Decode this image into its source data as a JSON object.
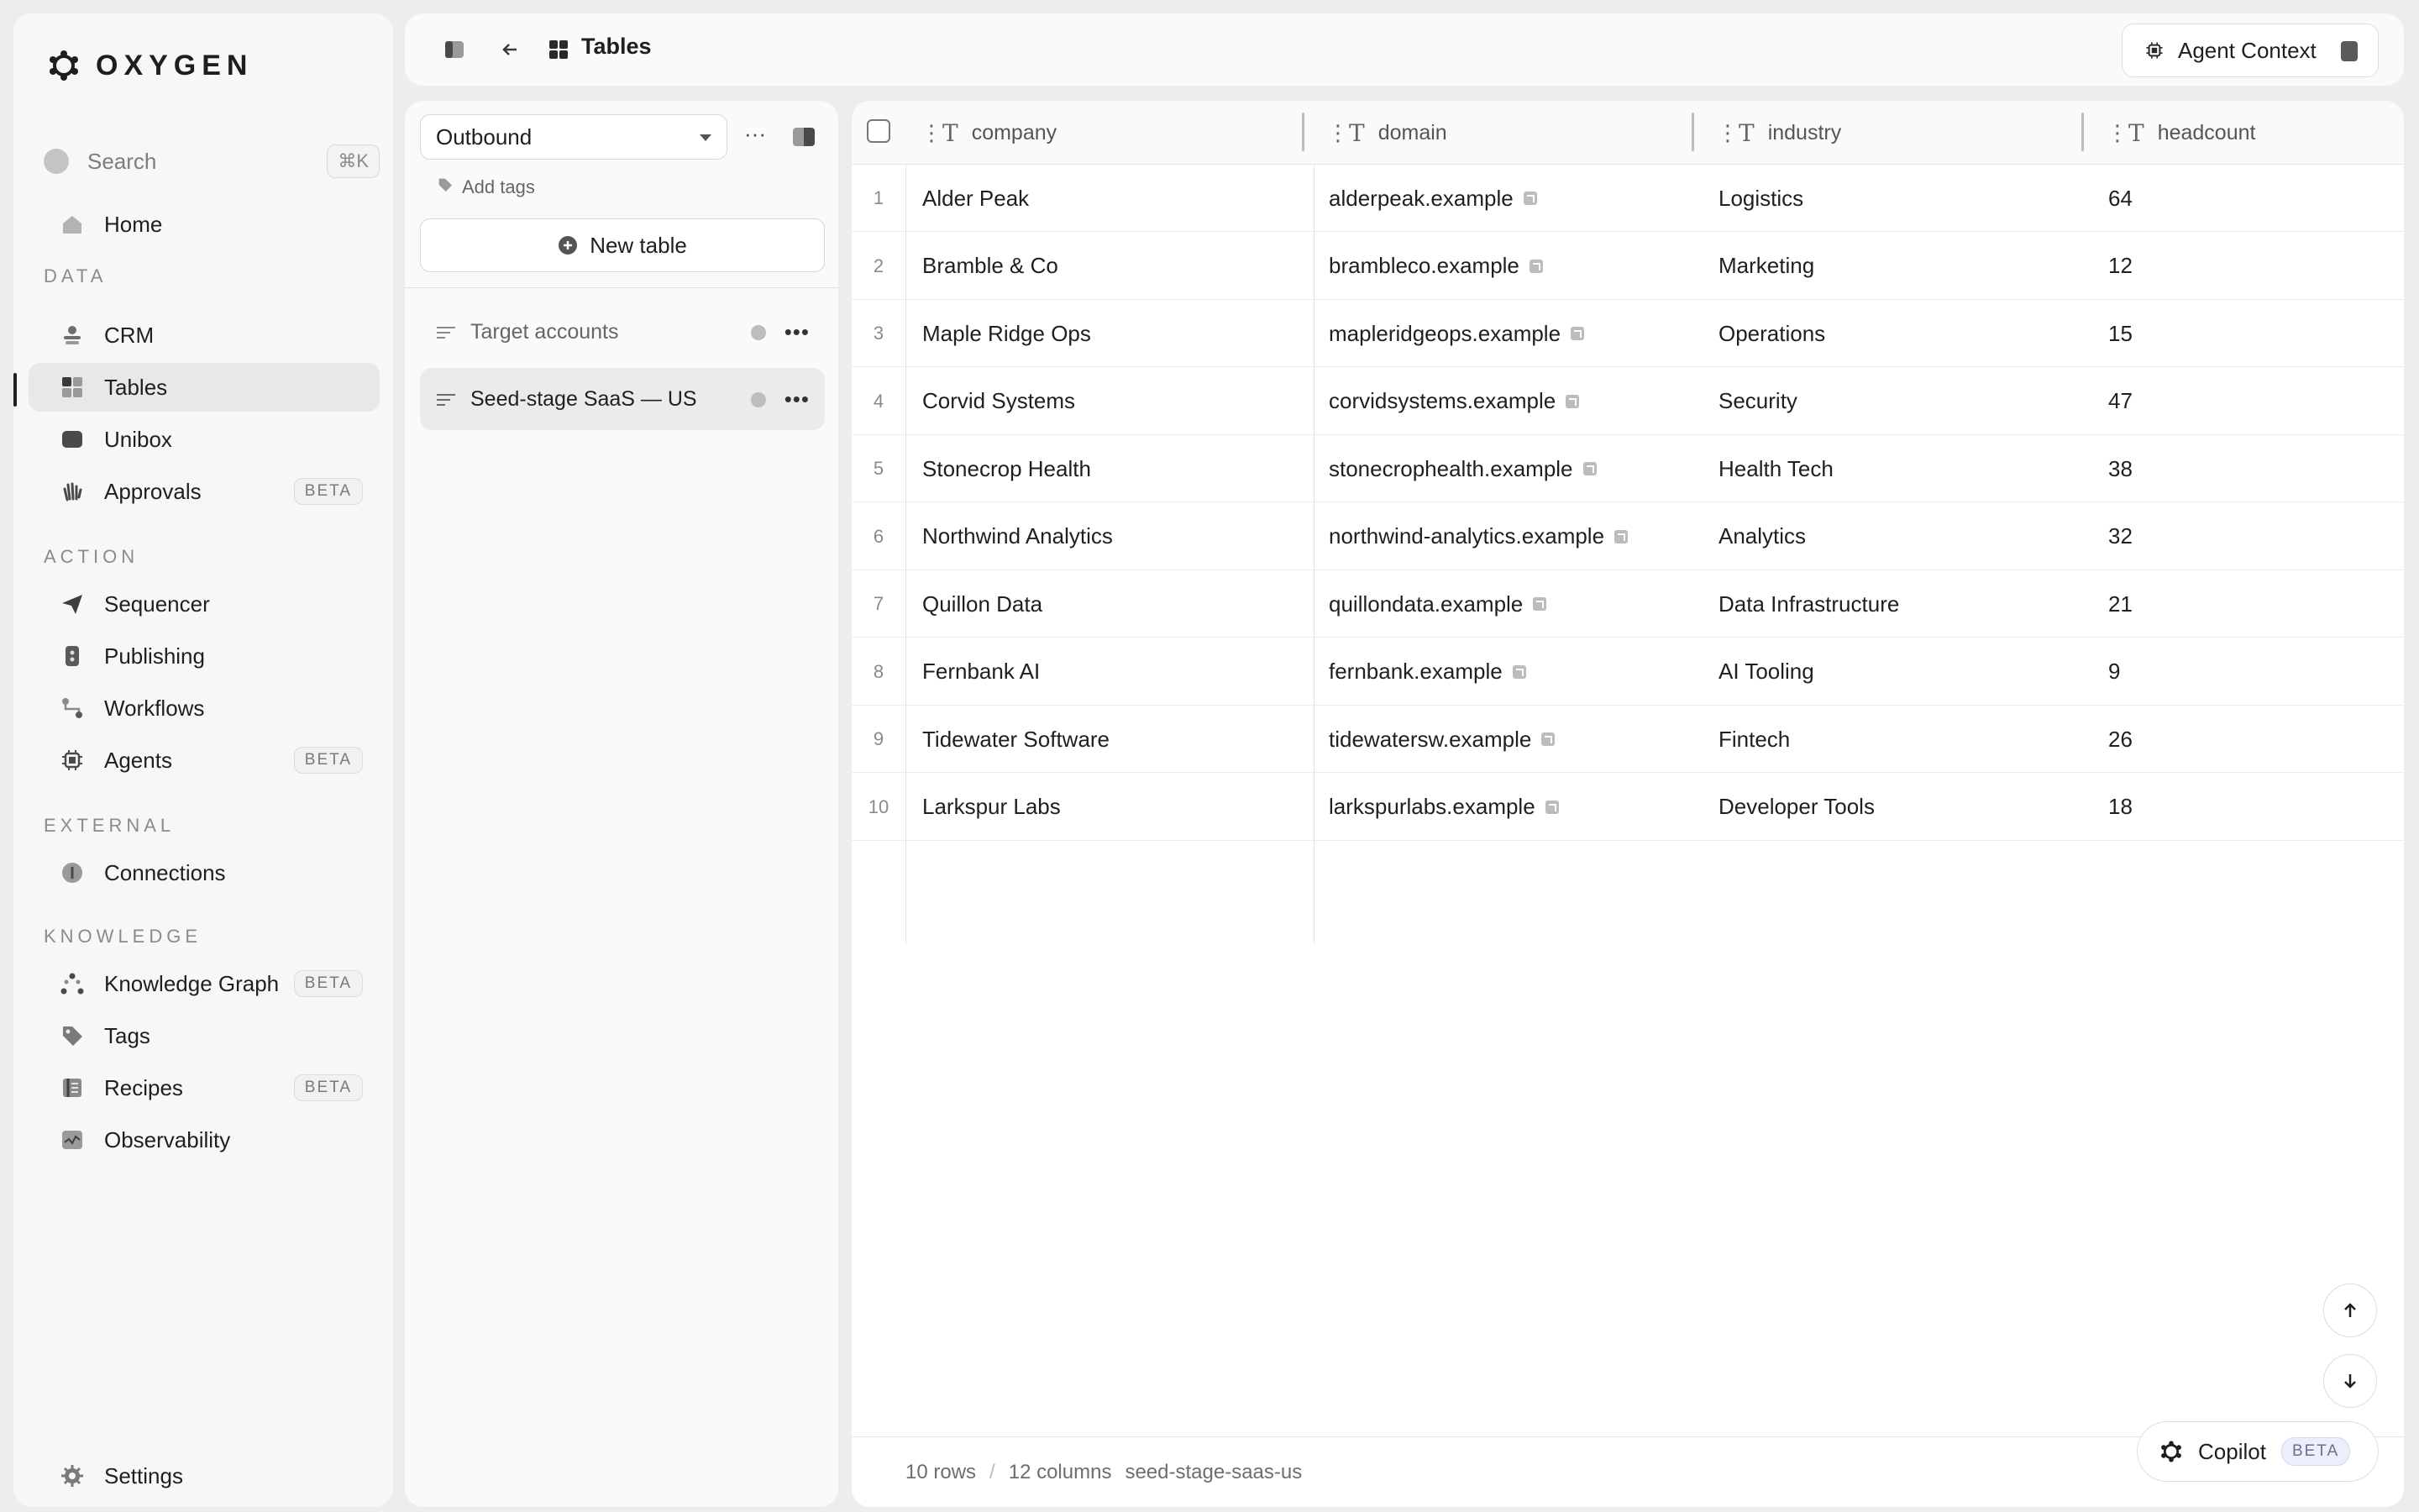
{
  "app": {
    "name": "OXYGEN"
  },
  "sidebar": {
    "search_label": "Search",
    "search_shortcut": "⌘K",
    "home": "Home",
    "sections": {
      "data": "DATA",
      "action": "ACTION",
      "external": "EXTERNAL",
      "knowledge": "KNOWLEDGE"
    },
    "items": {
      "crm": "CRM",
      "tables": "Tables",
      "unibox": "Unibox",
      "approvals": "Approvals",
      "sequencer": "Sequencer",
      "publishing": "Publishing",
      "workflows": "Workflows",
      "agents": "Agents",
      "connections": "Connections",
      "knowledge_graph": "Knowledge Graph",
      "tags": "Tags",
      "recipes": "Recipes",
      "observability": "Observability",
      "settings": "Settings"
    },
    "beta_label": "BETA"
  },
  "topbar": {
    "title": "Tables",
    "agent_context": "Agent Context"
  },
  "tables_panel": {
    "workspace_select": "Outbound",
    "add_tags": "Add tags",
    "new_table": "New table",
    "tables": [
      {
        "name": "Target accounts"
      },
      {
        "name": "Seed-stage SaaS — US"
      }
    ]
  },
  "grid": {
    "columns": [
      "company",
      "domain",
      "industry",
      "headcount"
    ],
    "rows": [
      {
        "n": "1",
        "company": "Alder Peak",
        "domain": "alderpeak.example",
        "industry": "Logistics",
        "headcount": "64"
      },
      {
        "n": "2",
        "company": "Bramble & Co",
        "domain": "brambleco.example",
        "industry": "Marketing",
        "headcount": "12"
      },
      {
        "n": "3",
        "company": "Maple Ridge Ops",
        "domain": "mapleridgeops.example",
        "industry": "Operations",
        "headcount": "15"
      },
      {
        "n": "4",
        "company": "Corvid Systems",
        "domain": "corvidsystems.example",
        "industry": "Security",
        "headcount": "47"
      },
      {
        "n": "5",
        "company": "Stonecrop Health",
        "domain": "stonecrophealth.example",
        "industry": "Health Tech",
        "headcount": "38"
      },
      {
        "n": "6",
        "company": "Northwind Analytics",
        "domain": "northwind-analytics.example",
        "industry": "Analytics",
        "headcount": "32"
      },
      {
        "n": "7",
        "company": "Quillon Data",
        "domain": "quillondata.example",
        "industry": "Data Infrastructure",
        "headcount": "21"
      },
      {
        "n": "8",
        "company": "Fernbank AI",
        "domain": "fernbank.example",
        "industry": "AI Tooling",
        "headcount": "9"
      },
      {
        "n": "9",
        "company": "Tidewater Software",
        "domain": "tidewatersw.example",
        "industry": "Fintech",
        "headcount": "26"
      },
      {
        "n": "10",
        "company": "Larkspur Labs",
        "domain": "larkspurlabs.example",
        "industry": "Developer Tools",
        "headcount": "18"
      }
    ],
    "footer": {
      "rows": "10 rows",
      "separator": "/",
      "columns": "12 columns",
      "slug": "seed-stage-saas-us"
    }
  },
  "copilot": {
    "label": "Copilot",
    "badge": "BETA"
  }
}
